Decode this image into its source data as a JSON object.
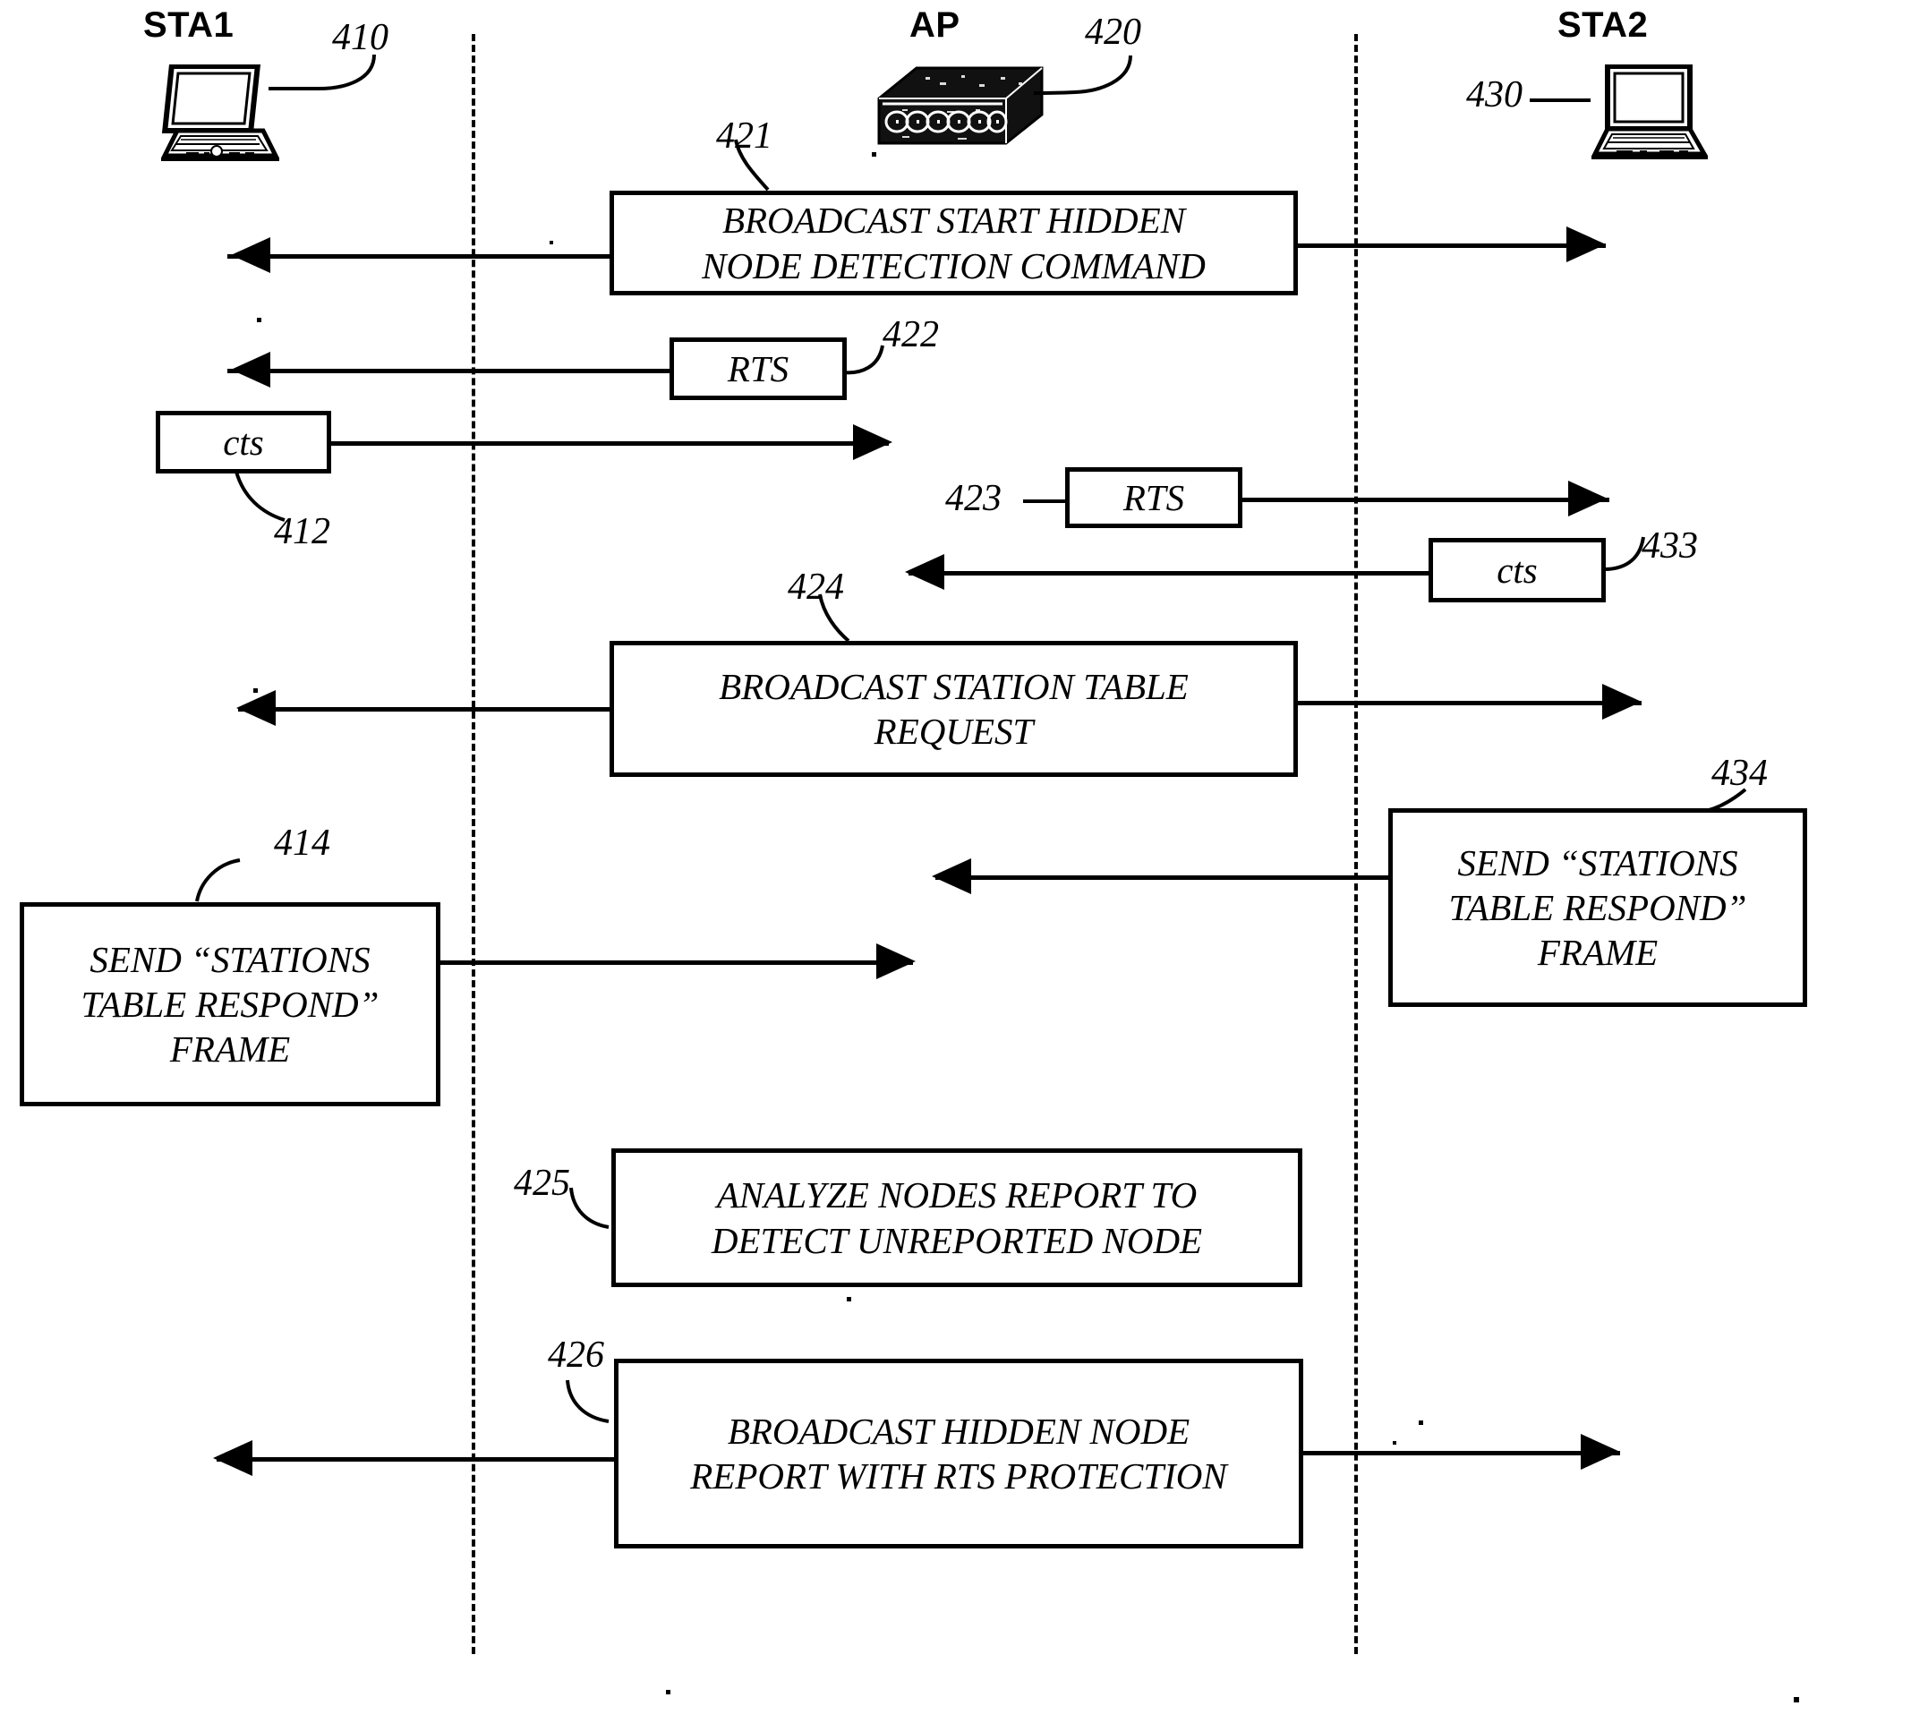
{
  "figure": {
    "type": "message-sequence-diagram",
    "columns": [
      {
        "id": "sta1",
        "label": "STA1",
        "ref": "410",
        "icon": "laptop-icon"
      },
      {
        "id": "ap",
        "label": "AP",
        "ref": "420",
        "icon": "access-point-icon"
      },
      {
        "id": "sta2",
        "label": "STA2",
        "ref": "430",
        "icon": "laptop-icon"
      }
    ],
    "messages": [
      {
        "ref": "421",
        "text_lines": [
          "BROADCAST START HIDDEN",
          "NODE DETECTION COMMAND"
        ],
        "origin": "ap",
        "to": [
          "sta1",
          "sta2"
        ]
      },
      {
        "ref": "422",
        "text_lines": [
          "RTS"
        ],
        "origin": "ap",
        "to": [
          "sta1"
        ]
      },
      {
        "ref": "412",
        "text_lines": [
          "cts"
        ],
        "origin": "sta1",
        "to": [
          "ap"
        ]
      },
      {
        "ref": "423",
        "text_lines": [
          "RTS"
        ],
        "origin": "ap",
        "to": [
          "sta2"
        ]
      },
      {
        "ref": "433",
        "text_lines": [
          "cts"
        ],
        "origin": "sta2",
        "to": [
          "ap"
        ]
      },
      {
        "ref": "424",
        "text_lines": [
          "BROADCAST STATION TABLE",
          "REQUEST"
        ],
        "origin": "ap",
        "to": [
          "sta1",
          "sta2"
        ]
      },
      {
        "ref": "434",
        "text_lines": [
          "SEND “STATIONS",
          "TABLE RESPOND”",
          "FRAME"
        ],
        "origin": "sta2",
        "to": [
          "ap"
        ]
      },
      {
        "ref": "414",
        "text_lines": [
          "SEND  “STATIONS",
          "TABLE RESPOND”",
          "FRAME"
        ],
        "origin": "sta1",
        "to": [
          "ap"
        ]
      },
      {
        "ref": "425",
        "text_lines": [
          "ANALYZE NODES REPORT TO",
          "DETECT UNREPORTED NODE"
        ],
        "origin": "ap",
        "to": []
      },
      {
        "ref": "426",
        "text_lines": [
          "BROADCAST HIDDEN NODE",
          "REPORT WITH RTS PROTECTION"
        ],
        "origin": "ap",
        "to": [
          "sta1",
          "sta2"
        ]
      }
    ]
  },
  "labels": {
    "sta1_title": "STA1",
    "ap_title": "AP",
    "sta2_title": "STA2",
    "ref_410": "410",
    "ref_420": "420",
    "ref_430": "430",
    "ref_421": "421",
    "ref_422": "422",
    "ref_412": "412",
    "ref_423": "423",
    "ref_433": "433",
    "ref_424": "424",
    "ref_434": "434",
    "ref_414": "414",
    "ref_425": "425",
    "ref_426": "426"
  },
  "boxes": {
    "b421_l1": "BROADCAST START HIDDEN",
    "b421_l2": "NODE DETECTION COMMAND",
    "b422": "RTS",
    "b412": "cts",
    "b423": "RTS",
    "b433": "cts",
    "b424_l1": "BROADCAST STATION TABLE",
    "b424_l2": "REQUEST",
    "b434_l1": "SEND “STATIONS",
    "b434_l2": "TABLE RESPOND”",
    "b434_l3": "FRAME",
    "b414_l1": "SEND  “STATIONS",
    "b414_l2": "TABLE RESPOND”",
    "b414_l3": "FRAME",
    "b425_l1": "ANALYZE NODES REPORT TO",
    "b425_l2": "DETECT UNREPORTED NODE",
    "b426_l1": "BROADCAST HIDDEN NODE",
    "b426_l2": "REPORT WITH RTS PROTECTION"
  },
  "colors": {
    "ink": "#000000",
    "paper": "#ffffff"
  }
}
